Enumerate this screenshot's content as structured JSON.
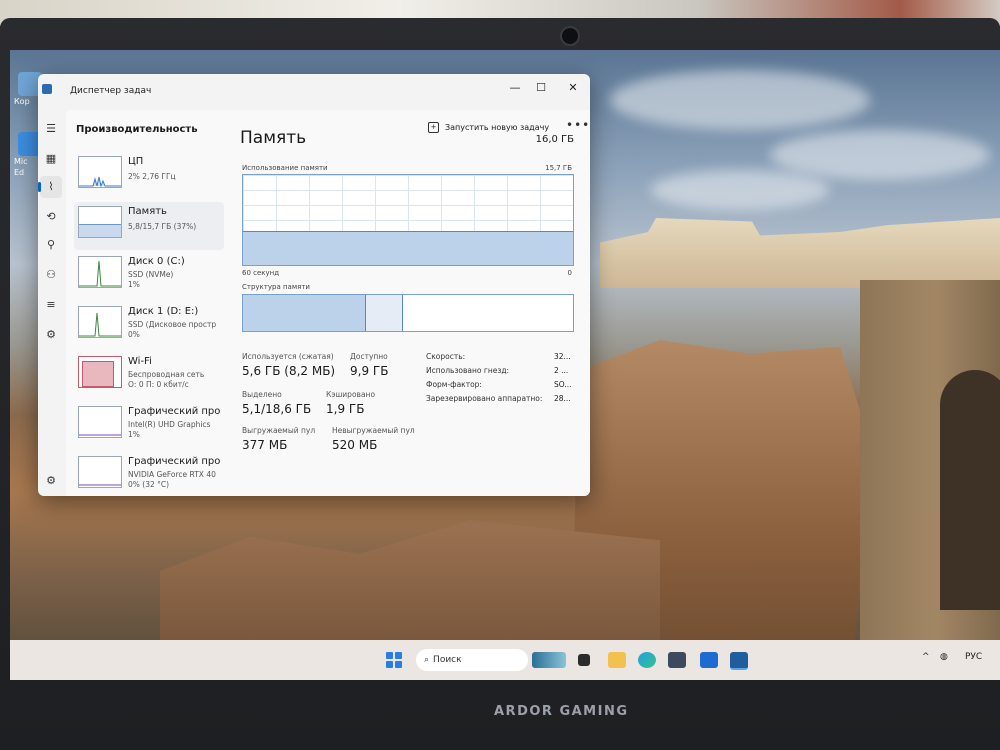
{
  "window": {
    "title": "Диспетчер задач",
    "minimize": "—",
    "maximize": "☐",
    "close": "✕"
  },
  "header": {
    "page_title": "Производительность",
    "run_task": "Запустить новую задачу",
    "more": "•••"
  },
  "perf_list": [
    {
      "name": "ЦП",
      "sub1": "2% 2,76 ГГц",
      "sub2": ""
    },
    {
      "name": "Память",
      "sub1": "5,8/15,7 ГБ (37%)",
      "sub2": ""
    },
    {
      "name": "Диск 0 (C:)",
      "sub1": "SSD (NVMe)",
      "sub2": "1%"
    },
    {
      "name": "Диск 1 (D: E:)",
      "sub1": "SSD (Дисковое простр",
      "sub2": "0%"
    },
    {
      "name": "Wi-Fi",
      "sub1": "Беспроводная сеть",
      "sub2": "О: 0 П: 0 кбит/с"
    },
    {
      "name": "Графический про",
      "sub1": "Intel(R) UHD Graphics",
      "sub2": "1%"
    },
    {
      "name": "Графический про",
      "sub1": "NVIDIA GeForce RTX 40",
      "sub2": "0% (32 °C)"
    }
  ],
  "memory": {
    "title": "Память",
    "total": "16,0 ГБ",
    "usage_label": "Использование памяти",
    "usage_max": "15,7 ГБ",
    "time_left": "60 секунд",
    "time_right": "0",
    "structure_label": "Структура памяти",
    "usage_fraction": 0.37,
    "used_fraction": 0.37,
    "modified_fraction": 0.11,
    "stats": {
      "in_use_label": "Используется (сжатая)",
      "in_use_value": "5,6 ГБ (8,2 МБ)",
      "available_label": "Доступно",
      "available_value": "9,9 ГБ",
      "committed_label": "Выделено",
      "committed_value": "5,1/18,6 ГБ",
      "cached_label": "Кэшировано",
      "cached_value": "1,9 ГБ",
      "paged_label": "Выгружаемый пул",
      "paged_value": "377 МБ",
      "nonpaged_label": "Невыгружаемый пул",
      "nonpaged_value": "520 МБ"
    },
    "props": [
      {
        "label": "Скорость:",
        "value": "32..."
      },
      {
        "label": "Использовано гнезд:",
        "value": "2 ..."
      },
      {
        "label": "Форм-фактор:",
        "value": "SO..."
      },
      {
        "label": "Зарезервировано аппаратно:",
        "value": "28..."
      }
    ]
  },
  "desktop": {
    "icon1_label": "Кор",
    "icon2_label": "Mic",
    "icon3_label": "Ed"
  },
  "taskbar": {
    "search_placeholder": "Поиск",
    "search_icon": "⌕",
    "lang": "РУС",
    "chevron": "^"
  },
  "bezel": {
    "brand": "ARDOR GAMING"
  },
  "colors": {
    "accent": "#0067c0",
    "memory_graph": "#5588c4",
    "wifi_graph": "#c35b6b"
  }
}
